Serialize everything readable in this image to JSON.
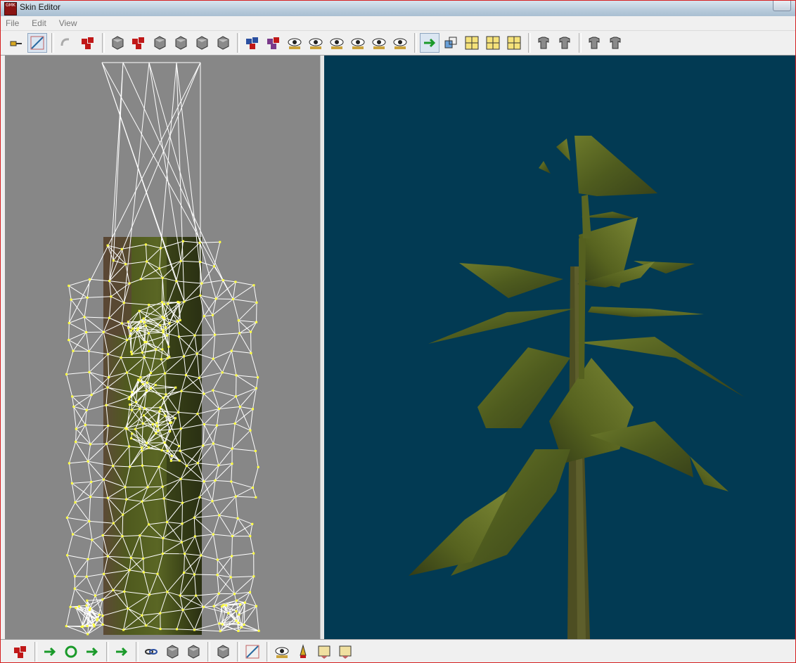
{
  "window": {
    "title": "Skin Editor",
    "app_icon_text": "G\nM\nK"
  },
  "menu": [
    "File",
    "Edit",
    "View"
  ],
  "colors": {
    "left_bg": "#878787",
    "right_bg": "#023a53",
    "mesh_line": "#ffffff",
    "vertex": "#ffff40",
    "foliage": "#4d5a1c",
    "foliage_light": "#6f7a2e",
    "trunk": "#4a4a20"
  },
  "toolbar": [
    {
      "icon": "pin-icon"
    },
    {
      "icon": "select-edge-icon",
      "active": true
    },
    {
      "sep": true
    },
    {
      "icon": "undo-icon"
    },
    {
      "icon": "redo-icon"
    },
    {
      "sep": true
    },
    {
      "icon": "cube-hammer-icon"
    },
    {
      "icon": "red-cubes-icon"
    },
    {
      "icon": "grey-cubes-icon"
    },
    {
      "icon": "cube-gray-1-icon"
    },
    {
      "icon": "cube-gray-2-icon"
    },
    {
      "icon": "cube-gray-3-icon"
    },
    {
      "sep": true
    },
    {
      "icon": "blue-cubes-icon"
    },
    {
      "icon": "purple-cubes-icon"
    },
    {
      "icon": "eye-plus-icon"
    },
    {
      "icon": "eye-1-icon"
    },
    {
      "icon": "eye-2-icon"
    },
    {
      "icon": "eye-3-icon"
    },
    {
      "icon": "eye-4-icon"
    },
    {
      "icon": "eye-5-icon"
    },
    {
      "sep": true
    },
    {
      "icon": "camera-move-icon",
      "active": true
    },
    {
      "icon": "resize-icon"
    },
    {
      "icon": "grid-add-icon"
    },
    {
      "icon": "grid-remove-icon"
    },
    {
      "icon": "grid-paint-icon"
    },
    {
      "sep": true
    },
    {
      "icon": "shirt-up-icon"
    },
    {
      "icon": "shirt-down-icon"
    },
    {
      "sep": true
    },
    {
      "icon": "flip-left-icon"
    },
    {
      "icon": "flip-right-icon"
    }
  ],
  "bottom_toolbar": [
    {
      "icon": "cube-red-icon"
    },
    {
      "sep": true
    },
    {
      "icon": "import-icon"
    },
    {
      "icon": "rotate-icon"
    },
    {
      "icon": "export-icon"
    },
    {
      "sep": true
    },
    {
      "icon": "move-cross-icon"
    },
    {
      "sep": true
    },
    {
      "icon": "link-icon"
    },
    {
      "icon": "cube-small-icon"
    },
    {
      "icon": "cube-half-icon"
    },
    {
      "sep": true
    },
    {
      "icon": "cube-delete-icon"
    },
    {
      "sep": true
    },
    {
      "icon": "draw-edge-icon"
    },
    {
      "sep": true
    },
    {
      "icon": "eyedropper-icon"
    },
    {
      "icon": "pencil-icon"
    },
    {
      "icon": "frame-1-icon"
    },
    {
      "icon": "frame-2-icon"
    }
  ]
}
